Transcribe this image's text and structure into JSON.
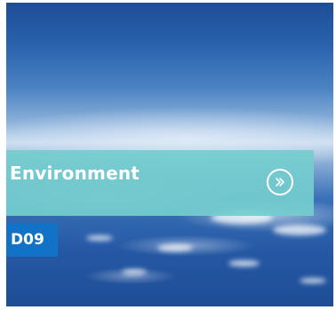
{
  "tile": {
    "title": "Environment",
    "code": "D09",
    "more_icon": "double-chevron-right-icon",
    "banner_color": "#74cdce",
    "badge_color": "#1273c6"
  }
}
